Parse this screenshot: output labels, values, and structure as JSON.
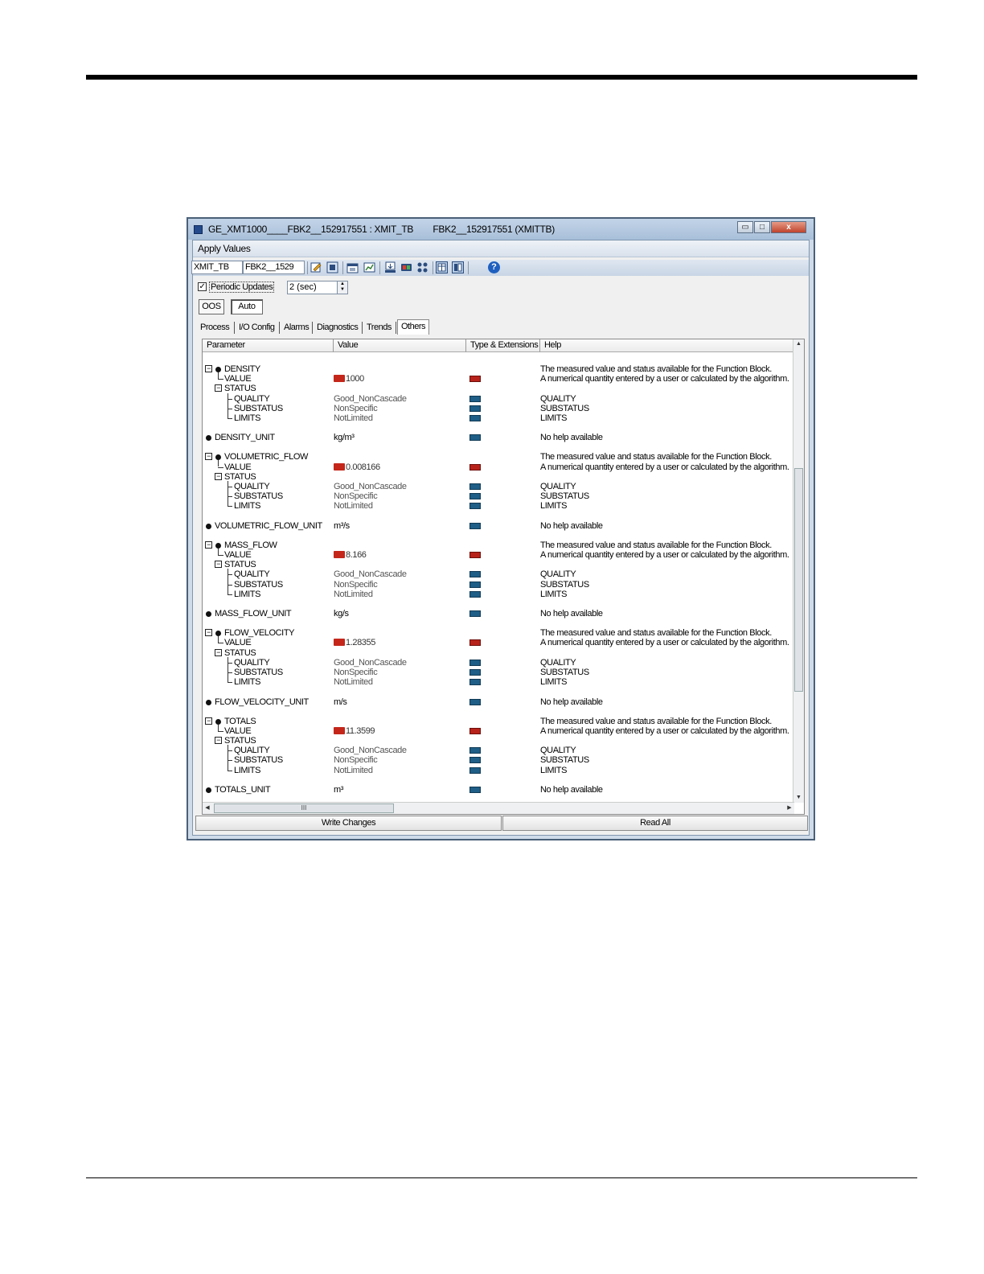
{
  "window": {
    "title": "GE_XMT1000____FBK2__152917551 : XMIT_TB        FBK2__152917551 (XMITTB)",
    "minimize_label": "▭",
    "maximize_label": "□",
    "close_label": "x"
  },
  "menu": {
    "apply_values": "Apply Values"
  },
  "toolbar": {
    "tag": "XMIT_TB",
    "device": "FBK2__1529",
    "help_icon": "?"
  },
  "periodic": {
    "label": "Periodic Updates",
    "checked": "✓",
    "interval": "2 (sec)"
  },
  "modes": {
    "oos": "OOS",
    "auto": "Auto"
  },
  "tabs": [
    "Process",
    "I/O Config",
    "Alarms",
    "Diagnostics",
    "Trends",
    "Others"
  ],
  "columns": {
    "parameter": "Parameter",
    "value": "Value",
    "type": "Type & Extensions",
    "help": "Help"
  },
  "groups": [
    {
      "name": "DENSITY",
      "value": "1000",
      "help_1": "The measured value and status available for the Function Block.",
      "help_2": "A numerical quantity entered by a user or calculated by the algorithm.",
      "quality": "Good_NonCascade",
      "substatus": "NonSpecific",
      "limits": "NotLimited",
      "unit_name": "DENSITY_UNIT",
      "unit_value": "kg/m³"
    },
    {
      "name": "VOLUMETRIC_FLOW",
      "value": "0.008166",
      "help_1": "The measured value and status available for the Function Block.",
      "help_2": "A numerical quantity entered by a user or calculated by the algorithm.",
      "quality": "Good_NonCascade",
      "substatus": "NonSpecific",
      "limits": "NotLimited",
      "unit_name": "VOLUMETRIC_FLOW_UNIT",
      "unit_value": "m³/s"
    },
    {
      "name": "MASS_FLOW",
      "value": "8.166",
      "help_1": "The measured value and status available for the Function Block.",
      "help_2": "A numerical quantity entered by a user or calculated by the algorithm.",
      "quality": "Good_NonCascade",
      "substatus": "NonSpecific",
      "limits": "NotLimited",
      "unit_name": "MASS_FLOW_UNIT",
      "unit_value": "kg/s"
    },
    {
      "name": "FLOW_VELOCITY",
      "value": "1.28355",
      "help_1": "The measured value and status available for the Function Block.",
      "help_2": "A numerical quantity entered by a user or calculated by the algorithm.",
      "quality": "Good_NonCascade",
      "substatus": "NonSpecific",
      "limits": "NotLimited",
      "unit_name": "FLOW_VELOCITY_UNIT",
      "unit_value": "m/s"
    },
    {
      "name": "TOTALS",
      "value": "11.3599",
      "help_1": "The measured value and status available for the Function Block.",
      "help_2": "A numerical quantity entered by a user or calculated by the algorithm.",
      "quality": "Good_NonCascade",
      "substatus": "NonSpecific",
      "limits": "NotLimited",
      "unit_name": "TOTALS_UNIT",
      "unit_value": "m³"
    }
  ],
  "row_labels": {
    "value": "VALUE",
    "status": "STATUS",
    "quality": "QUALITY",
    "substatus": "SUBSTATUS",
    "limits": "LIMITS",
    "help_quality": "QUALITY",
    "help_substatus": "SUBSTATUS",
    "help_limits": "LIMITS",
    "no_help": "No help available"
  },
  "scrollbar": {
    "grip": "III"
  },
  "buttons": {
    "write_changes": "Write Changes",
    "read_all": "Read All"
  }
}
